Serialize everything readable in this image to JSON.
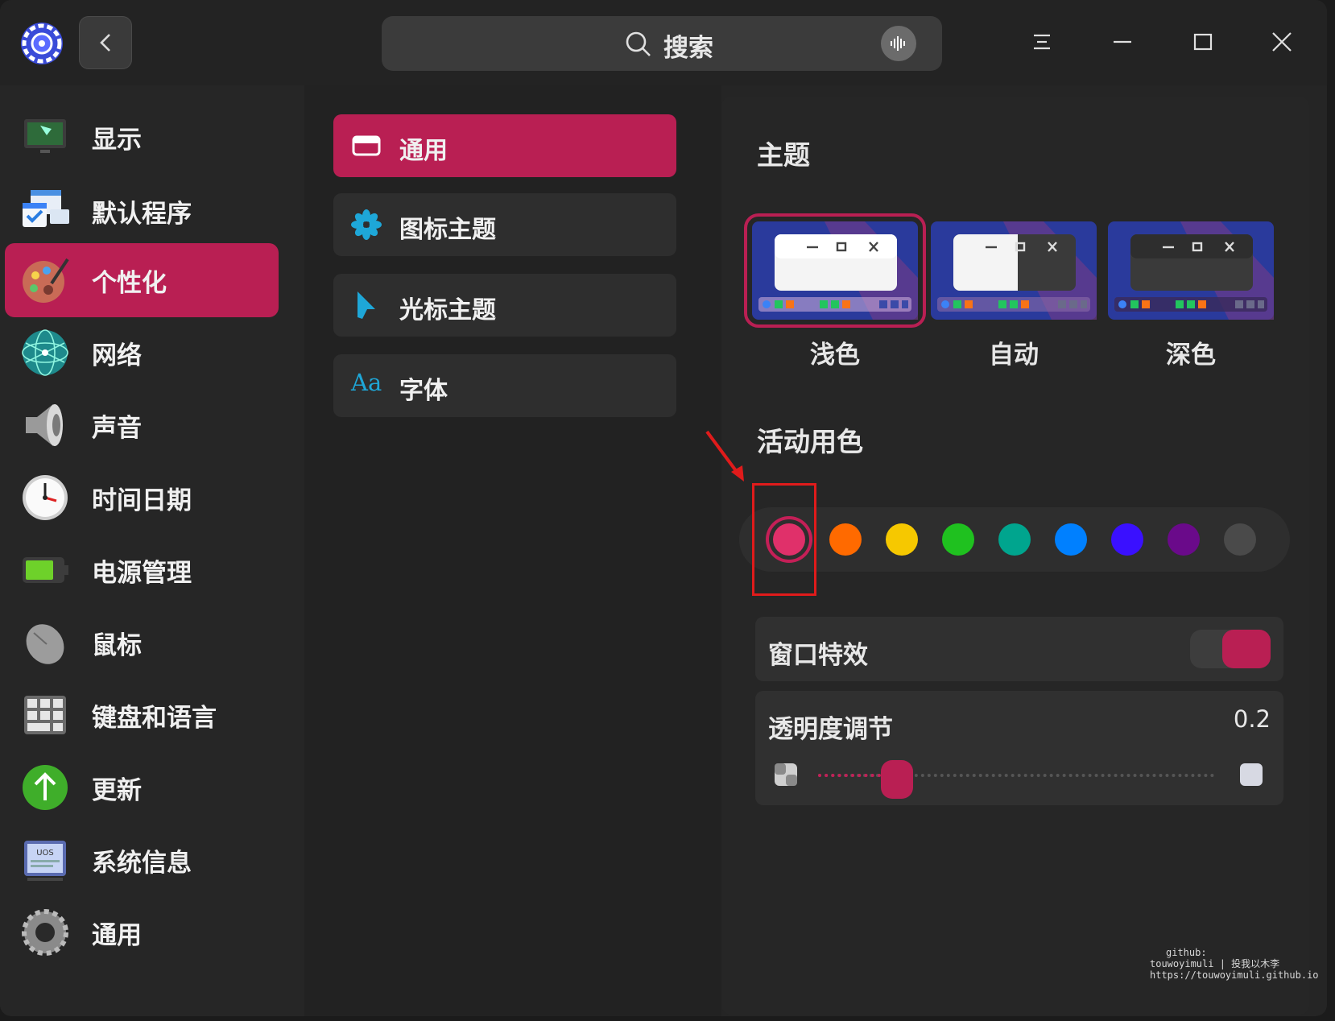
{
  "search": {
    "placeholder": "搜索"
  },
  "sidebar": {
    "items": [
      {
        "label": "显示",
        "icon": "display-icon"
      },
      {
        "label": "默认程序",
        "icon": "default-apps-icon"
      },
      {
        "label": "个性化",
        "icon": "palette-icon",
        "active": true
      },
      {
        "label": "网络",
        "icon": "network-icon"
      },
      {
        "label": "声音",
        "icon": "speaker-icon"
      },
      {
        "label": "时间日期",
        "icon": "clock-icon"
      },
      {
        "label": "电源管理",
        "icon": "battery-icon"
      },
      {
        "label": "鼠标",
        "icon": "mouse-icon"
      },
      {
        "label": "键盘和语言",
        "icon": "keyboard-icon"
      },
      {
        "label": "更新",
        "icon": "update-icon"
      },
      {
        "label": "系统信息",
        "icon": "system-info-icon"
      },
      {
        "label": "通用",
        "icon": "general-gear-icon"
      }
    ]
  },
  "subnav": {
    "items": [
      {
        "label": "通用",
        "icon": "window-icon",
        "active": true
      },
      {
        "label": "图标主题",
        "icon": "flower-icon"
      },
      {
        "label": "光标主题",
        "icon": "cursor-icon"
      },
      {
        "label": "字体",
        "icon": "font-icon",
        "icon_text": "Aa"
      }
    ]
  },
  "content": {
    "theme_title": "主题",
    "themes": [
      {
        "label": "浅色",
        "selected": true
      },
      {
        "label": "自动"
      },
      {
        "label": "深色"
      }
    ],
    "accent_title": "活动用色",
    "accent_colors": [
      "#e0306a",
      "#ff6a00",
      "#f6c800",
      "#1fc11f",
      "#00a58e",
      "#0080ff",
      "#3a10ff",
      "#6a0a8a",
      "#4a4a4a"
    ],
    "accent_selected": 0,
    "window_effect_label": "窗口特效",
    "window_effect_on": true,
    "transparency_label": "透明度调节",
    "transparency_value": "0.2"
  },
  "watermark": {
    "line1": "github:",
    "line2": "touwoyimuli",
    "line3": "投我以木李",
    "line4": "https://touwoyimuli.github.io"
  },
  "colors": {
    "accent": "#b91f53",
    "annotation": "#e01b1b"
  }
}
